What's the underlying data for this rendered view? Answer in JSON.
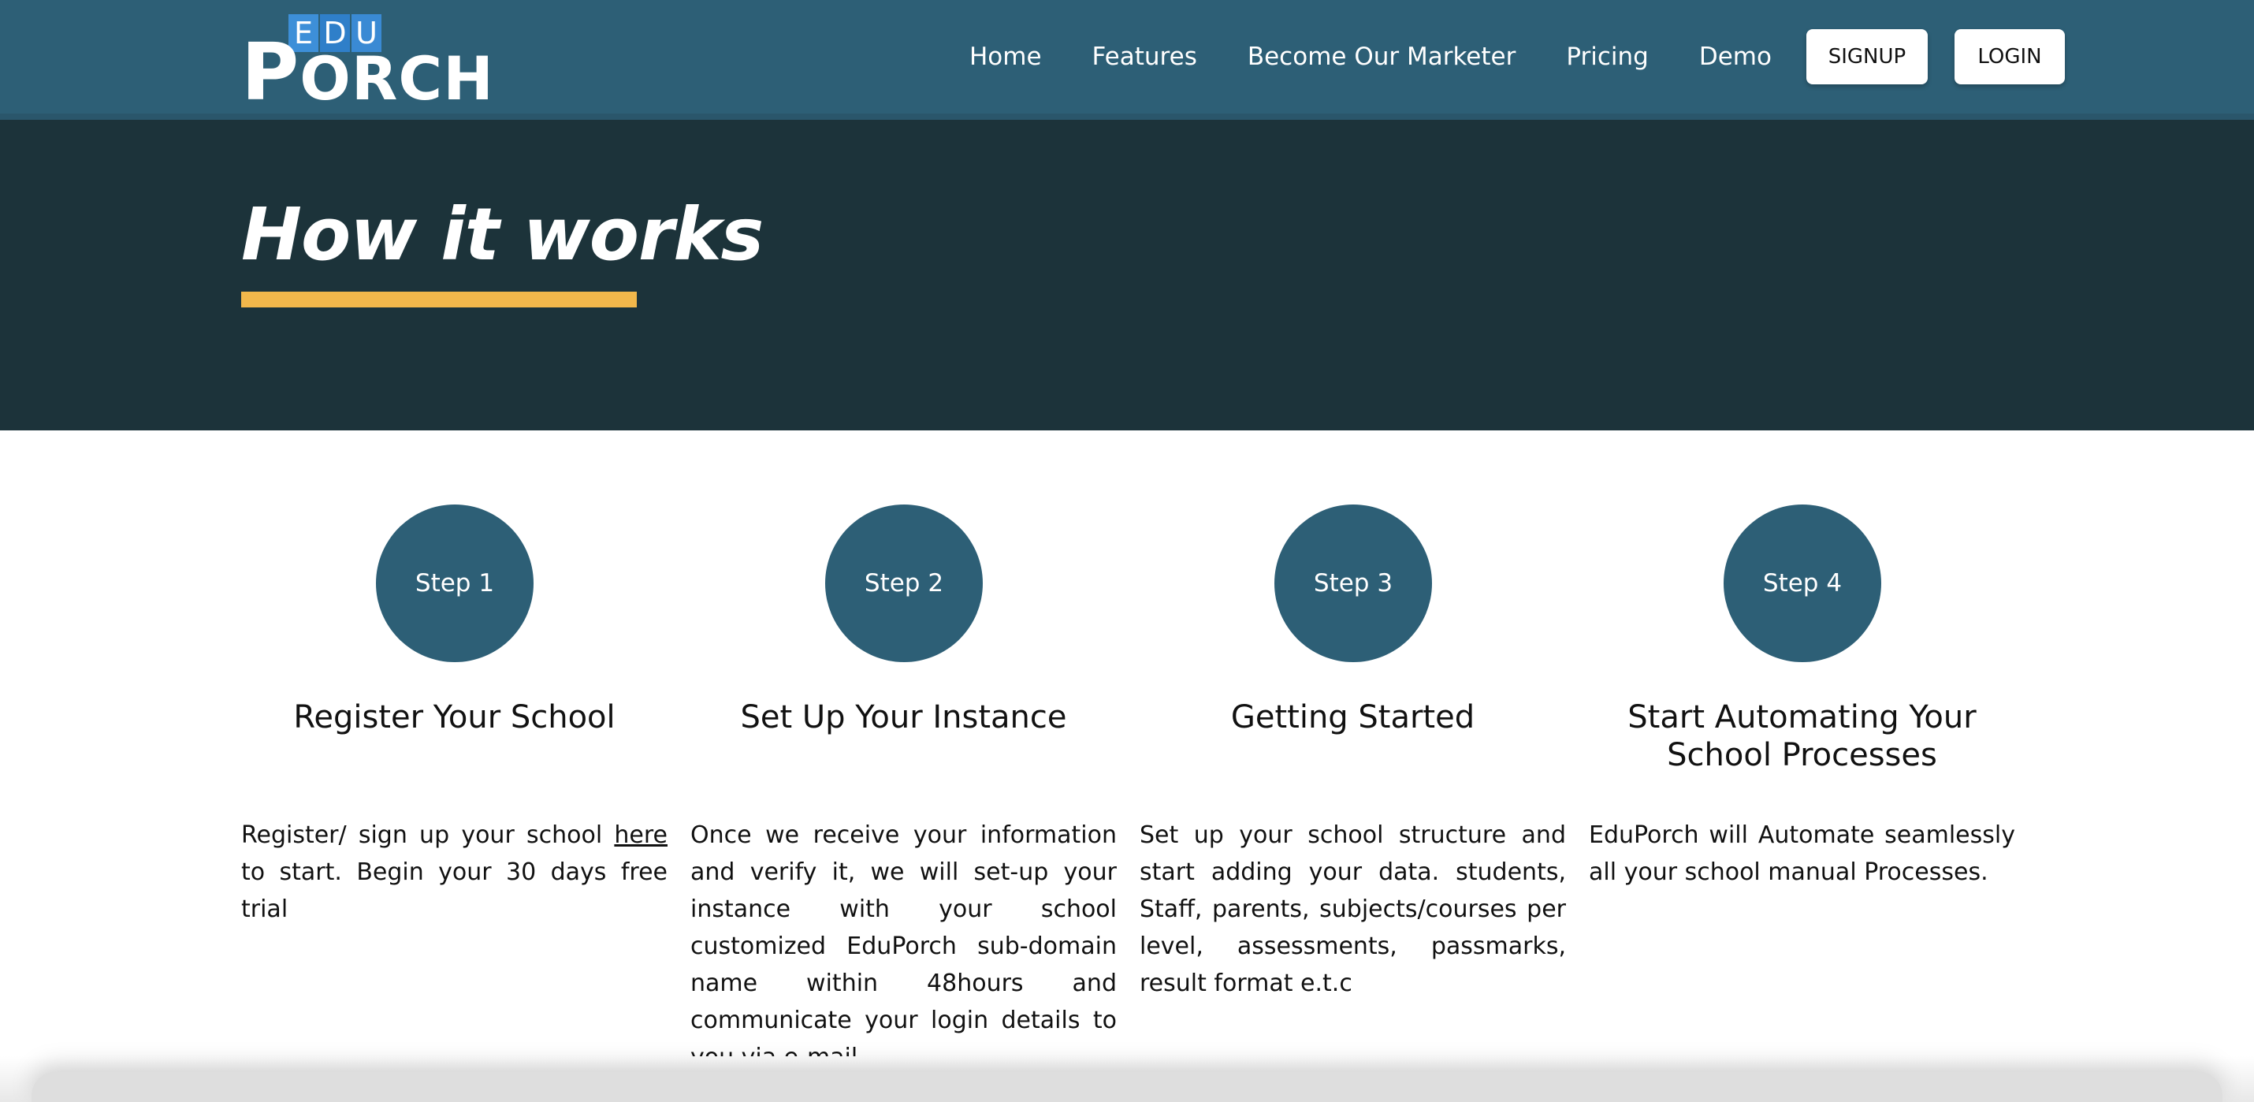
{
  "header": {
    "logo": {
      "top": "EDU",
      "letters": [
        "E",
        "D",
        "U"
      ],
      "bottom_first": "P",
      "bottom_rest": "ORCH"
    },
    "nav": [
      {
        "label": "Home"
      },
      {
        "label": "Features"
      },
      {
        "label": "Become Our Marketer"
      },
      {
        "label": "Pricing"
      },
      {
        "label": "Demo"
      }
    ],
    "signup_label": "SIGNUP",
    "login_label": "LOGIN"
  },
  "hero": {
    "title": "How it works",
    "underline_color": "#f2b84b",
    "background_color": "#1c333a"
  },
  "steps": [
    {
      "badge": "Step 1",
      "title": "Register Your School",
      "desc_before": "Register/ sign up your school ",
      "desc_link": "here",
      "desc_after": " to start. Begin your 30 days free trial"
    },
    {
      "badge": "Step 2",
      "title": "Set Up Your Instance",
      "desc": "Once we receive your information and verify it, we will set-up your instance with your school customized EduPorch sub-domain name within 48hours and communicate your login details to you via e-mail."
    },
    {
      "badge": "Step 3",
      "title": "Getting Started",
      "desc": "Set up your school structure and start adding your data. students, Staff, parents, subjects/courses per level, assessments, passmarks, result format e.t.c"
    },
    {
      "badge": "Step 4",
      "title": "Start Automating Your School Processes",
      "desc": "EduPorch will Automate seamlessly all your school manual Processes."
    }
  ],
  "colors": {
    "header": "#2d5f76",
    "accent_circle": "#2d5f76",
    "logo_blue": "#3d8fd8"
  }
}
